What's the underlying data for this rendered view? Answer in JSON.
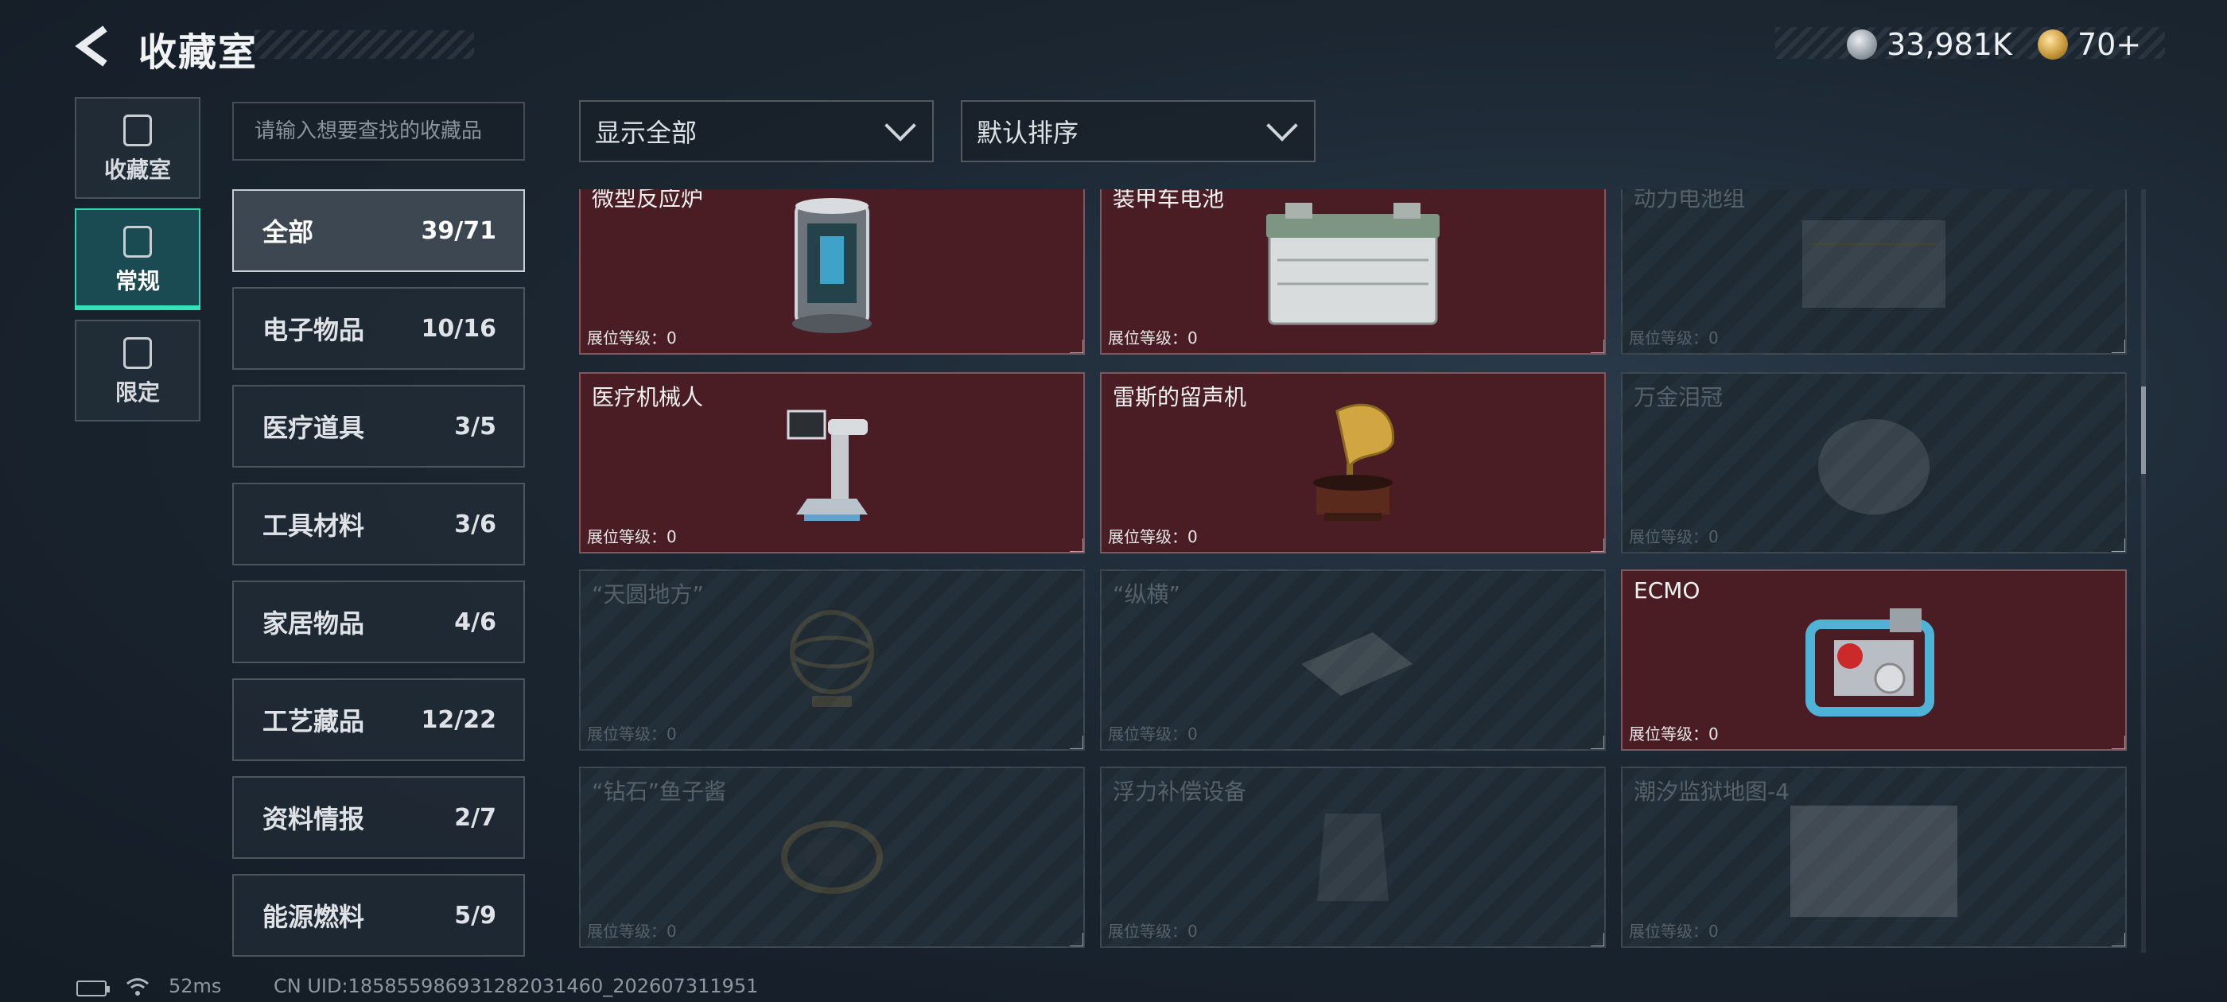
{
  "header": {
    "title": "收藏室",
    "currency_1": "33,981K",
    "currency_2": "70+"
  },
  "nav": [
    {
      "label": "收藏室",
      "icon": "vault-icon"
    },
    {
      "label": "常规",
      "icon": "regular-collection-icon",
      "active": true
    },
    {
      "label": "限定",
      "icon": "limited-collection-icon"
    }
  ],
  "search": {
    "placeholder": "请输入想要查找的收藏品"
  },
  "categories": [
    {
      "name": "全部",
      "count": "39/71",
      "active": true
    },
    {
      "name": "电子物品",
      "count": "10/16"
    },
    {
      "name": "医疗道具",
      "count": "3/5"
    },
    {
      "name": "工具材料",
      "count": "3/6"
    },
    {
      "name": "家居物品",
      "count": "4/6"
    },
    {
      "name": "工艺藏品",
      "count": "12/22"
    },
    {
      "name": "资料情报",
      "count": "2/7"
    },
    {
      "name": "能源燃料",
      "count": "5/9"
    }
  ],
  "filters": {
    "show": "显示全部",
    "sort": "默认排序"
  },
  "items": [
    {
      "name": "微型反应炉",
      "level": "展位等级：0",
      "owned": true,
      "icon": "reactor-icon"
    },
    {
      "name": "装甲车电池",
      "level": "展位等级：0",
      "owned": true,
      "icon": "battery-icon"
    },
    {
      "name": "动力电池组",
      "level": "展位等级：0",
      "owned": false,
      "icon": "power-pack-icon"
    },
    {
      "name": "医疗机械人",
      "level": "展位等级：0",
      "owned": true,
      "icon": "medical-robot-icon"
    },
    {
      "name": "雷斯的留声机",
      "level": "展位等级：0",
      "owned": true,
      "icon": "gramophone-icon"
    },
    {
      "name": "万金泪冠",
      "level": "展位等级：0",
      "owned": false,
      "icon": "crown-icon"
    },
    {
      "name": "“天圆地方”",
      "level": "展位等级：0",
      "owned": false,
      "icon": "armillary-icon"
    },
    {
      "name": "“纵横”",
      "level": "展位等级：0",
      "owned": false,
      "icon": "chessboard-icon"
    },
    {
      "name": "ECMO",
      "level": "展位等级：0",
      "owned": true,
      "icon": "ecmo-icon"
    },
    {
      "name": "“钻石”鱼子酱",
      "level": "展位等级：0",
      "owned": false,
      "icon": "caviar-icon"
    },
    {
      "name": "浮力补偿设备",
      "level": "展位等级：0",
      "owned": false,
      "icon": "bcd-icon"
    },
    {
      "name": "潮汐监狱地图-4",
      "level": "展位等级：0",
      "owned": false,
      "icon": "map-icon"
    }
  ],
  "footer": {
    "ping": "52ms",
    "uid": "CN UID:1858559869312820314​60_202607311951"
  }
}
